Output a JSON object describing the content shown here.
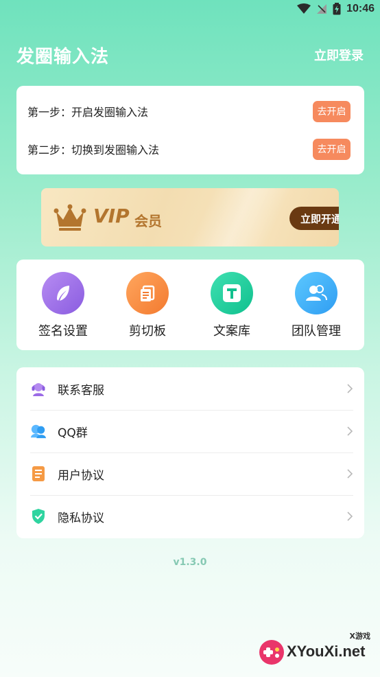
{
  "status_bar": {
    "time": "10:46"
  },
  "header": {
    "title": "发圈输入法",
    "login": "立即登录"
  },
  "steps": [
    {
      "label": "第一步：开启发圈输入法",
      "button": "去开启"
    },
    {
      "label": "第二步：切换到发圈输入法",
      "button": "去开启"
    }
  ],
  "vip": {
    "badge": "VIP",
    "title": "会员",
    "button": "立即开通"
  },
  "features": [
    {
      "label": "签名设置",
      "icon": "feather-icon"
    },
    {
      "label": "剪切板",
      "icon": "clipboard-icon"
    },
    {
      "label": "文案库",
      "icon": "text-icon"
    },
    {
      "label": "团队管理",
      "icon": "team-icon"
    }
  ],
  "menu": [
    {
      "label": "联系客服",
      "icon": "customer-service-icon"
    },
    {
      "label": "QQ群",
      "icon": "qq-group-icon"
    },
    {
      "label": "用户协议",
      "icon": "document-icon"
    },
    {
      "label": "隐私协议",
      "icon": "shield-icon"
    }
  ],
  "version": "v1.3.0",
  "watermark": {
    "site": "XYouXi.net",
    "tag": "X游戏"
  },
  "colors": {
    "accent_green": "#6fe2bd",
    "step_button": "#f68a5e",
    "vip_button": "#6a3a12",
    "vip_text": "#b3752e"
  }
}
